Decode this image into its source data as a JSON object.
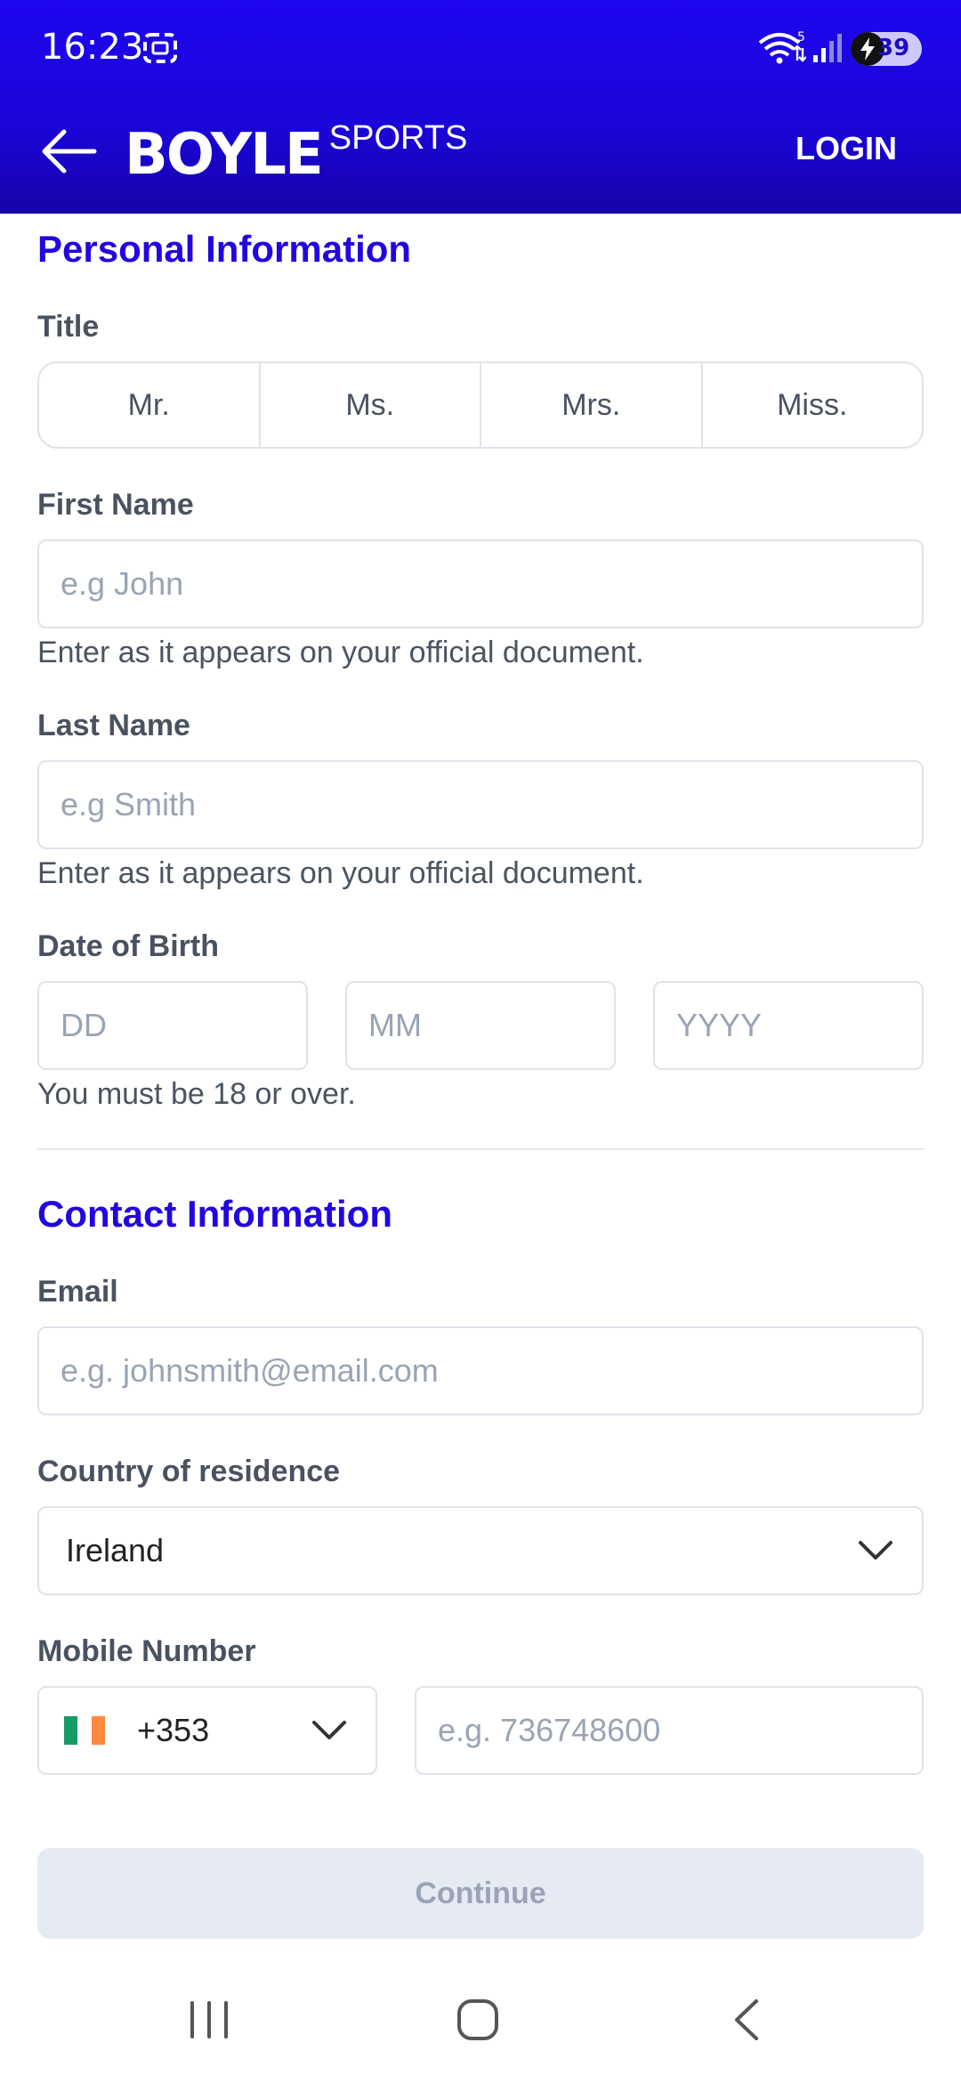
{
  "status_bar": {
    "time": "16:23",
    "battery": "39",
    "wifi_badge": "5"
  },
  "header": {
    "logo_main": "BOYLE",
    "logo_sub": "SPORTS",
    "login_label": "LOGIN",
    "brand_color": "#1d06f0"
  },
  "personal": {
    "section_title": "Personal Information",
    "title_label": "Title",
    "title_options": [
      "Mr.",
      "Ms.",
      "Mrs.",
      "Miss."
    ],
    "first_name_label": "First Name",
    "first_name_placeholder": "e.g John",
    "first_name_hint": "Enter as it appears on your official document.",
    "last_name_label": "Last Name",
    "last_name_placeholder": "e.g Smith",
    "last_name_hint": "Enter as it appears on your official document.",
    "dob_label": "Date of Birth",
    "dob_day_placeholder": "DD",
    "dob_month_placeholder": "MM",
    "dob_year_placeholder": "YYYY",
    "dob_hint": "You must be 18 or over."
  },
  "contact": {
    "section_title": "Contact Information",
    "email_label": "Email",
    "email_placeholder": "e.g. johnsmith@email.com",
    "country_label": "Country of residence",
    "country_value": "Ireland",
    "mobile_label": "Mobile Number",
    "dial_code": "+353",
    "mobile_placeholder": "e.g. 736748600"
  },
  "actions": {
    "continue_label": "Continue"
  }
}
